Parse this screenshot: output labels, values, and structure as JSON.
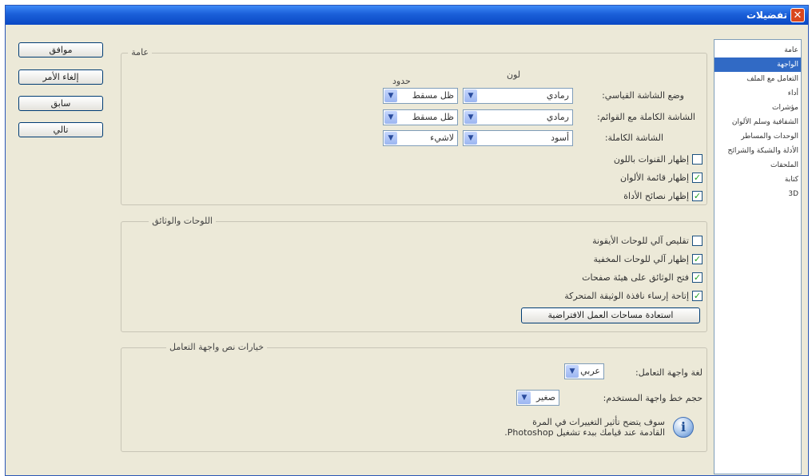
{
  "window": {
    "title": "تفضيلات"
  },
  "buttons": {
    "ok": "موافق",
    "cancel": "إلغاء الأمر",
    "prev": "سابق",
    "next": "تالي"
  },
  "categories": [
    "عامة",
    "الواجهة",
    "التعامل مع الملف",
    "أداء",
    "مؤشرات",
    "الشفافية وسلم الألوان",
    "الوحدات والمساطر",
    "الأدلة والشبكة والشرائح",
    "الملحقات",
    "كتابة",
    "3D"
  ],
  "general": {
    "legend": "عامة",
    "col_color": "لون",
    "col_border": "حدود",
    "rows": [
      {
        "label": "وضع الشاشة القياسي:",
        "color": "رمادي",
        "border": "ظل مسقط"
      },
      {
        "label": "الشاشة الكاملة مع القوائم:",
        "color": "رمادي",
        "border": "ظل مسقط"
      },
      {
        "label": "الشاشة الكاملة:",
        "color": "أسود",
        "border": "لاشيء"
      }
    ],
    "checks": [
      {
        "label": "إظهار القنوات باللون",
        "checked": false
      },
      {
        "label": "إظهار قائمة الألوان",
        "checked": true
      },
      {
        "label": "إظهار نصائح الأداة",
        "checked": true
      }
    ]
  },
  "panels": {
    "legend": "اللوحات والوثائق",
    "checks": [
      {
        "label": "تقليص آلي للوحات الأيقونة",
        "checked": false
      },
      {
        "label": "إظهار آلي للوحات المخفية",
        "checked": true
      },
      {
        "label": "فتح الوثائق على هيئة صفحات",
        "checked": true
      },
      {
        "label": "إتاحة إرساء نافذة الوثيقة المتحركة",
        "checked": true
      }
    ],
    "restore_button": "استعادة مساحات العمل الافتراضية"
  },
  "ui_text": {
    "legend": "خيارات نص واجهة التعامل",
    "language_label": "لغة واجهة التعامل:",
    "language_value": "عربي",
    "font_size_label": "حجم خط واجهة المستخدم:",
    "font_size_value": "صغير",
    "note_line1": "سوف يتضح تأثير التغييرات في المرة",
    "note_line2": "القادمة عند قيامك ببدء تشغيل Photoshop."
  },
  "icons": {
    "close": "close-icon",
    "dropdown": "chevron-down-icon",
    "info": "info-icon",
    "check": "check-icon"
  },
  "colors": {
    "titlebar": "#0a48c4",
    "selection": "#316ac5",
    "close": "#d9481e",
    "check": "#21a121"
  }
}
